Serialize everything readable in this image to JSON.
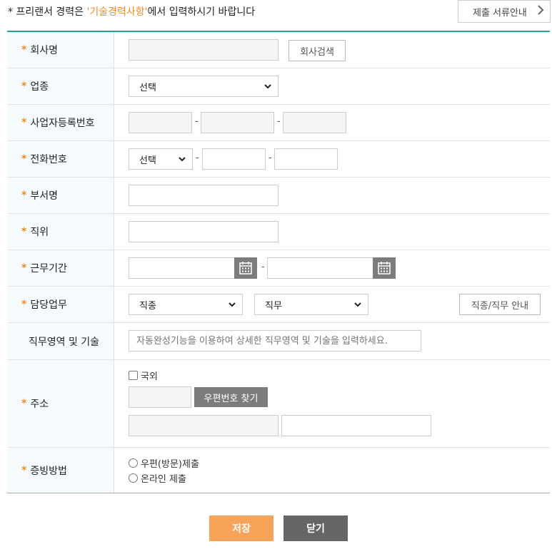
{
  "notice": {
    "prefix": "* 프리랜서 경력은 ",
    "highlight": "'기술경력사항'",
    "suffix": "에서 입력하시기 바랍니다"
  },
  "guide_button": {
    "label": "제출 서류안내",
    "icon": "chevron-right-icon"
  },
  "form": {
    "required_mark": "*",
    "company": {
      "label": "회사명",
      "search_button": "회사검색",
      "value": ""
    },
    "industry": {
      "label": "업종",
      "selected": "선택"
    },
    "business_reg": {
      "label": "사업자등록번호",
      "separator": "-"
    },
    "phone": {
      "label": "전화번호",
      "area_selected": "선택",
      "separator": "-"
    },
    "department": {
      "label": "부서명"
    },
    "position": {
      "label": "직위"
    },
    "work_period": {
      "label": "근무기간",
      "separator": "-",
      "icon": "calendar-icon"
    },
    "duty": {
      "label": "담당업무",
      "job_type_selected": "직종",
      "job_selected": "직무",
      "guide_button": "직종/직무 안내"
    },
    "skills": {
      "label": "직무영역 및 기술",
      "placeholder": "자동완성기능을 이용하여 상세한 직무영역 및 기술을 입력하세요."
    },
    "address": {
      "label": "주소",
      "overseas_label": "국외",
      "zip_button": "우편번호 찾기"
    },
    "proof": {
      "label": "증빙방법",
      "options": [
        "우편(방문)제출",
        "온라인 제출"
      ]
    }
  },
  "actions": {
    "save": "저장",
    "close": "닫기"
  },
  "colors": {
    "accent": "#f08a24",
    "border_top": "#27a0a0",
    "save_bg": "#f7a45a",
    "close_bg": "#666666"
  }
}
